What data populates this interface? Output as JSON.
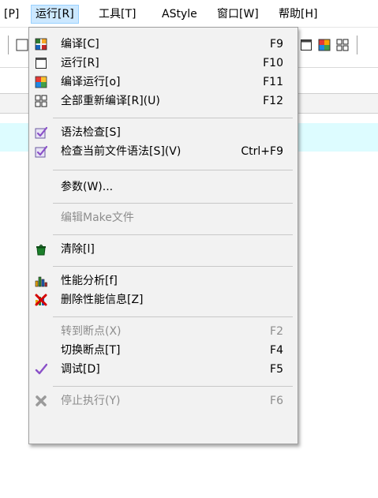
{
  "menubar": {
    "items": [
      {
        "label": "[P]"
      },
      {
        "label": "运行[R]"
      },
      {
        "label": "工具[T]"
      },
      {
        "label": "AStyle"
      },
      {
        "label": "窗口[W]"
      },
      {
        "label": "帮助[H]"
      }
    ]
  },
  "menu": {
    "items": [
      {
        "label": "编译[C]",
        "shortcut": "F9",
        "icon": "compile-grid-icon"
      },
      {
        "label": "运行[R]",
        "shortcut": "F10",
        "icon": "run-window-icon"
      },
      {
        "label": "编译运行[o]",
        "shortcut": "F11",
        "icon": "compile-run-icon"
      },
      {
        "label": "全部重新编译[R](U)",
        "shortcut": "F12",
        "icon": "rebuild-all-icon"
      },
      {
        "label": "语法检查[S]",
        "shortcut": "",
        "icon": "syntax-check-icon"
      },
      {
        "label": "检查当前文件语法[S](V)",
        "shortcut": "Ctrl+F9",
        "icon": "syntax-check-file-icon"
      },
      {
        "label": "参数(W)...",
        "shortcut": ""
      },
      {
        "label": "编辑Make文件",
        "shortcut": ""
      },
      {
        "label": "清除[l]",
        "shortcut": "",
        "icon": "clean-trash-icon"
      },
      {
        "label": "性能分析[f]",
        "shortcut": "",
        "icon": "profile-chart-icon"
      },
      {
        "label": "删除性能信息[Z]",
        "shortcut": "",
        "icon": "delete-profile-icon"
      },
      {
        "label": "转到断点(X)",
        "shortcut": "F2"
      },
      {
        "label": "切换断点[T]",
        "shortcut": "F4"
      },
      {
        "label": "调试[D]",
        "shortcut": "F5",
        "icon": "debug-check-icon"
      },
      {
        "label": "停止执行(Y)",
        "shortcut": "F6",
        "icon": "stop-x-icon"
      }
    ]
  }
}
